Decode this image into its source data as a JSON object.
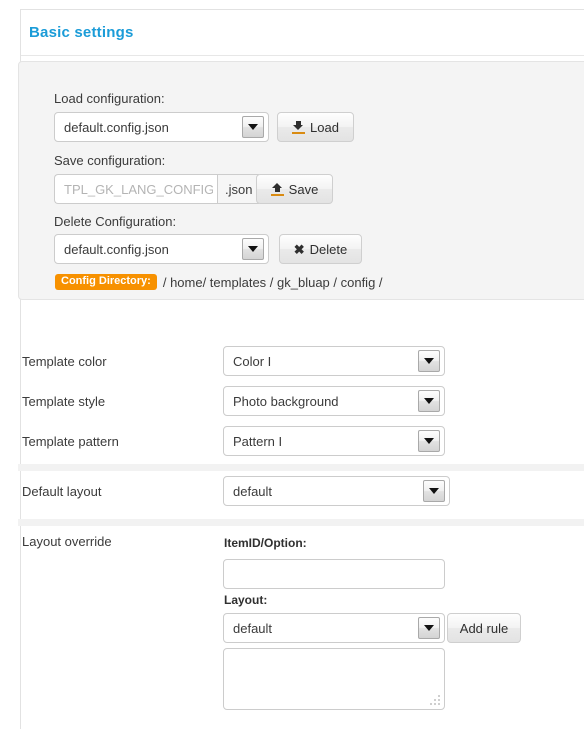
{
  "panel": {
    "title": "Basic settings"
  },
  "config_box": {
    "load": {
      "label": "Load configuration:",
      "selected": "default.config.json",
      "button_label": "Load",
      "button_icon": "download-icon"
    },
    "save": {
      "label": "Save configuration:",
      "placeholder": "TPL_GK_LANG_CONFIG_",
      "value": "",
      "extension": ".json",
      "button_label": "Save",
      "button_icon": "upload-icon"
    },
    "delete": {
      "label": "Delete Configuration:",
      "selected": "default.config.json",
      "button_label": "Delete",
      "button_icon": "cross-icon"
    },
    "config_directory": {
      "badge": "Config Directory:",
      "path": "/ home/ templates / gk_bluap / config /",
      "badge_color": "#f79100"
    }
  },
  "settings": {
    "template_color": {
      "label": "Template color",
      "selected": "Color I"
    },
    "template_style": {
      "label": "Template style",
      "selected": "Photo background"
    },
    "template_pattern": {
      "label": "Template pattern",
      "selected": "Pattern I"
    },
    "default_layout": {
      "label": "Default layout",
      "selected": "default"
    }
  },
  "layout_override": {
    "label": "Layout override",
    "itemid_label": "ItemID/Option:",
    "itemid_value": "",
    "itemid_placeholder": "",
    "layout_label": "Layout:",
    "layout_selected": "default",
    "add_rule_label": "Add rule",
    "rules_value": "",
    "rules_placeholder": ""
  },
  "theme": {
    "accent": "#1b9cd8",
    "badge": "#f79100",
    "panel_bg": "#f4f4f4"
  }
}
